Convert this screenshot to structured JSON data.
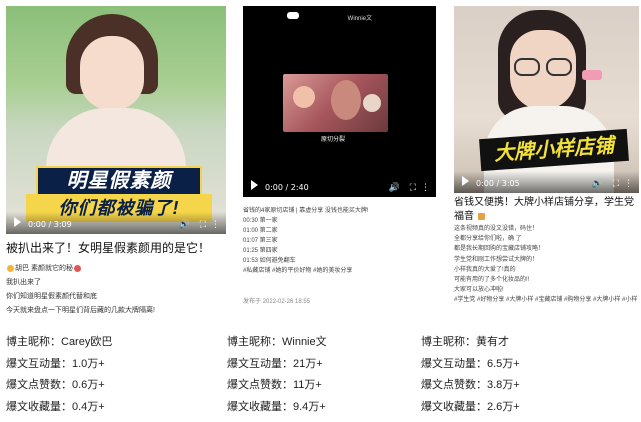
{
  "cards": [
    {
      "video": {
        "time": "0:00 / 3:09",
        "banner_top": "明星假素颜",
        "banner_bottom": "你们都被骗了!"
      },
      "title": "被扒出来了！女明星假素颜用的是它！",
      "lines": [
        "胡巴 素颜就它的秘",
        "我扒出来了",
        "你们知道明星假素颜代替和底",
        "今天就来盘点一下明星们背后藏的几款大牌隔离!"
      ]
    },
    {
      "video": {
        "time": "0:00 / 2:40",
        "watermark": "Winnie文",
        "caption": "原切分裂"
      },
      "lines": [
        "省钱的4家原切店铺 | 靠虚分享 没钱也能买大牌!",
        "00:30 第一家",
        "01:00 第二家",
        "01:07 第三家",
        "01:25 第四家",
        "01:53 如何避免翻车",
        "#私藏店铺 #她的平价好物 #她的美妆分享"
      ],
      "date": "发布于 2022-02-26 18:55"
    },
    {
      "video": {
        "time": "0:00 / 3:05",
        "banner": "大牌小样店铺"
      },
      "title": "省钱又便携！大牌小样店铺分享，学生党福音",
      "lines": [
        "这条视频真的没文没错，码住！",
        "全都分享给你们啦，确 了",
        "都是我长期回购的宝藏店铺攻略！",
        "学生党和刚工作想尝试大牌的！",
        "小样我真的大爱了!真的",
        "可能有用的了多个化妆品的!!",
        "大家可以放心冲啦!",
        "#学生党 #好物分享 #大牌小样 #宝藏店铺 #购物分享 #大牌小样 #小样"
      ]
    }
  ],
  "stats": [
    {
      "name_label": "博主昵称：",
      "name": "Carey欧巴",
      "interactions_label": "爆文互动量：",
      "interactions": "1.0万+",
      "likes_label": "爆文点赞数：",
      "likes": "0.6万+",
      "favorites_label": "爆文收藏量：",
      "favorites": "0.4万+"
    },
    {
      "name_label": "博主昵称：",
      "name": "Winnie文",
      "interactions_label": "爆文互动量：",
      "interactions": "21万+",
      "likes_label": "爆文点赞数：",
      "likes": "11万+",
      "favorites_label": "爆文收藏量：",
      "favorites": "9.4万+"
    },
    {
      "name_label": "博主昵称：",
      "name": "黄有才",
      "interactions_label": "爆文互动量：",
      "interactions": "6.5万+",
      "likes_label": "爆文点赞数：",
      "likes": "3.8万+",
      "favorites_label": "爆文收藏量：",
      "favorites": "2.6万+"
    }
  ],
  "icons": {
    "play": "play-icon",
    "volume": "volume-icon",
    "fullscreen": "fullscreen-icon",
    "more": "more-icon"
  }
}
